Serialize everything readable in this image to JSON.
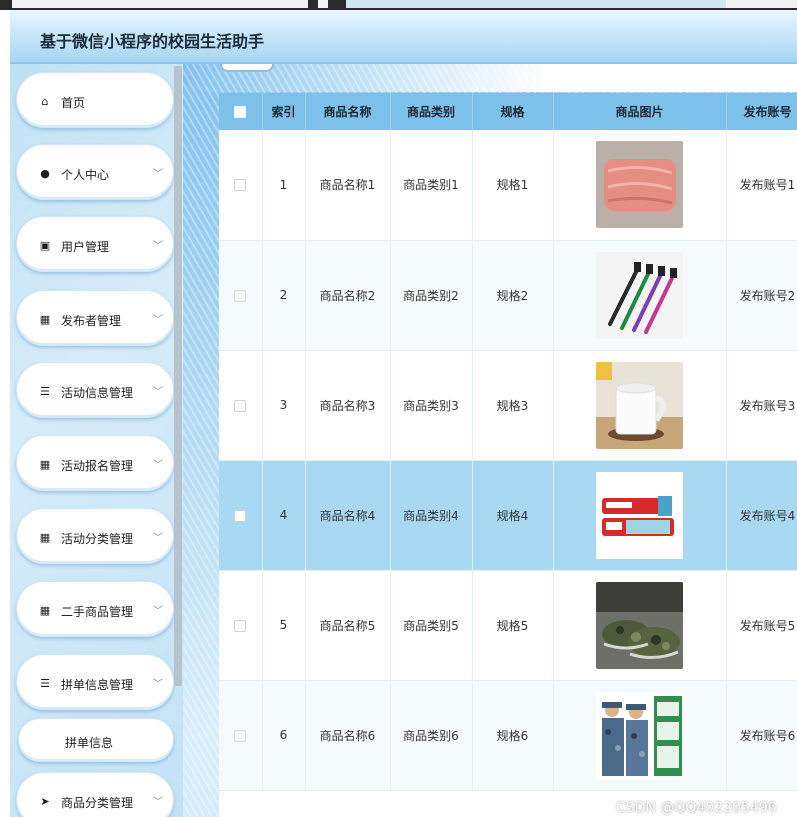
{
  "header": {
    "title": "基于微信小程序的校园生活助手"
  },
  "sidebar": {
    "items": [
      {
        "label": "首页",
        "icon": "home-icon",
        "glyph": "⌂",
        "expandable": false
      },
      {
        "label": "个人中心",
        "icon": "user-icon",
        "glyph": "●",
        "expandable": true
      },
      {
        "label": "用户管理",
        "icon": "clipboard-icon",
        "glyph": "▣",
        "expandable": true
      },
      {
        "label": "发布者管理",
        "icon": "grid-icon",
        "glyph": "▦",
        "expandable": true
      },
      {
        "label": "活动信息管理",
        "icon": "list-icon",
        "glyph": "☰",
        "expandable": true
      },
      {
        "label": "活动报名管理",
        "icon": "grid-icon",
        "glyph": "▦",
        "expandable": true
      },
      {
        "label": "活动分类管理",
        "icon": "grid-icon",
        "glyph": "▦",
        "expandable": true
      },
      {
        "label": "二手商品管理",
        "icon": "grid-icon",
        "glyph": "▦",
        "expandable": true
      },
      {
        "label": "拼单信息管理",
        "icon": "list-icon",
        "glyph": "☰",
        "expandable": true
      },
      {
        "label": "拼单信息",
        "icon": "",
        "glyph": "",
        "expandable": false,
        "submenu": true
      },
      {
        "label": "商品分类管理",
        "icon": "send-icon",
        "glyph": "➤",
        "expandable": true
      }
    ],
    "chevron": "﹀"
  },
  "table": {
    "columns": [
      "索引",
      "商品名称",
      "商品类别",
      "规格",
      "商品图片",
      "发布账号"
    ],
    "rows": [
      {
        "index": "1",
        "name": "商品名称1",
        "category": "商品类别1",
        "spec": "规格1",
        "image": "blanket-image",
        "account": "发布账号1"
      },
      {
        "index": "2",
        "name": "商品名称2",
        "category": "商品类别2",
        "spec": "规格2",
        "image": "toothbrush-image",
        "account": "发布账号2"
      },
      {
        "index": "3",
        "name": "商品名称3",
        "category": "商品类别3",
        "spec": "规格3",
        "image": "mug-image",
        "account": "发布账号3"
      },
      {
        "index": "4",
        "name": "商品名称4",
        "category": "商品类别4",
        "spec": "规格4",
        "image": "toothpaste-image",
        "account": "发布账号4"
      },
      {
        "index": "5",
        "name": "商品名称5",
        "category": "商品类别5",
        "spec": "规格5",
        "image": "camo-shoes-image",
        "account": "发布账号5"
      },
      {
        "index": "6",
        "name": "商品名称6",
        "category": "商品类别6",
        "spec": "规格6",
        "image": "camo-uniform-image",
        "account": "发布账号6"
      }
    ],
    "highlighted_row": "4"
  },
  "watermark": "CSDN @QQ402205496",
  "colors": {
    "header_bg": "#c9e7f9",
    "table_header": "#7ec1e8",
    "row_highlight": "#a9d8f2",
    "sidebar_bg": "#c2e2f6"
  }
}
